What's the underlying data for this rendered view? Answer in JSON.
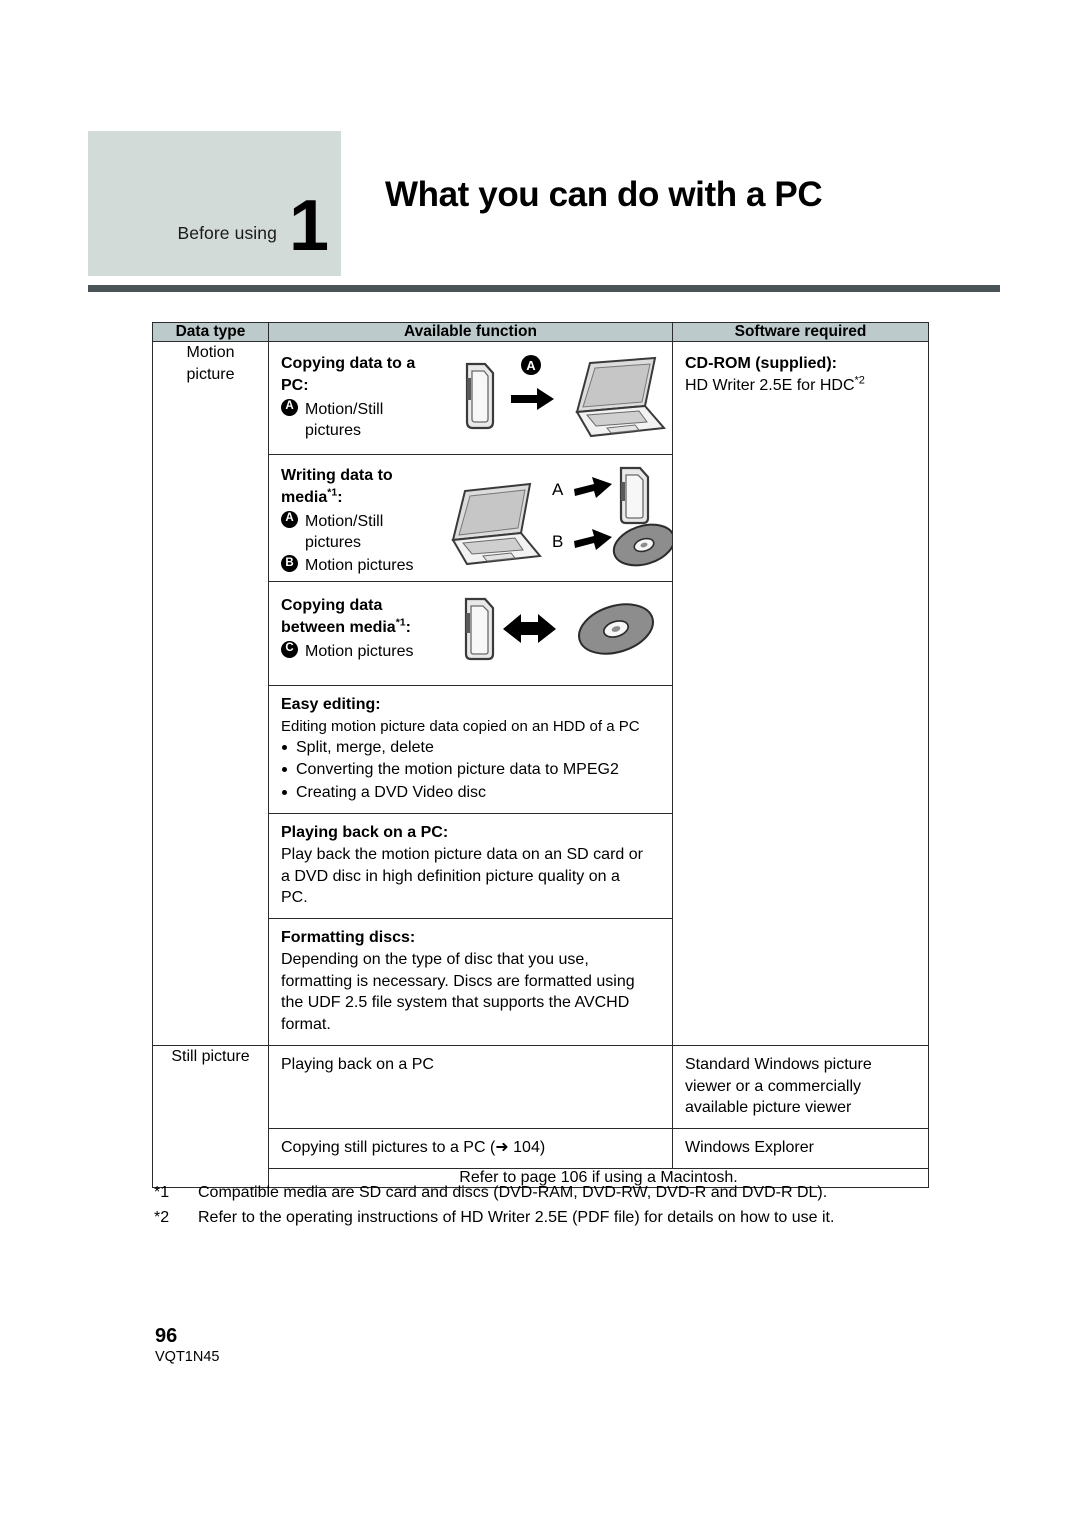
{
  "header": {
    "chapter_label": "Before using",
    "chapter_number": "1",
    "title": "What you can do with a PC"
  },
  "table": {
    "columns": [
      "Data type",
      "Available function",
      "Software required"
    ],
    "row_labels": {
      "motion": "Motion\npicture",
      "motion_line1": "Motion",
      "motion_line2": "picture",
      "still": "Still picture"
    },
    "software": {
      "cdrom_title": "CD-ROM (supplied):",
      "cdrom_body": "HD Writer 2.5E for HDC",
      "cdrom_ref": "*2",
      "still_viewer": "Standard Windows picture viewer or a commercially available picture viewer",
      "still_explorer": "Windows Explorer"
    },
    "functions": {
      "copy_to_pc": {
        "title_line1": "Copying data to a",
        "title_line2": "PC:",
        "badge_a": "A",
        "item_a_line1": "Motion/Still",
        "item_a_line2": "pictures",
        "diagram_label_a": "A"
      },
      "write_to_media": {
        "title_line1": "Writing data to",
        "title_line2": "media",
        "title_ref": "*1",
        "title_colon": ":",
        "badge_a": "A",
        "item_a_line1": "Motion/Still",
        "item_a_line2": "pictures",
        "badge_b": "B",
        "item_b": "Motion pictures",
        "diagram_label_a": "A",
        "diagram_label_b": "B"
      },
      "copy_between_media": {
        "title_line1": "Copying data",
        "title_line2": "between media",
        "title_ref": "*1",
        "title_colon": ":",
        "badge_c": "C",
        "item_c": "Motion pictures"
      },
      "easy_editing": {
        "title": "Easy editing:",
        "intro": "Editing motion picture data copied on an HDD of a PC",
        "bullets": [
          "Split, merge, delete",
          "Converting the motion picture data to MPEG2",
          "Creating a DVD Video disc"
        ]
      },
      "playing_back_pc": {
        "title": "Playing back on a PC:",
        "body_line1": "Play back the motion picture data on an SD card or",
        "body_line2": "a DVD disc in high definition picture quality on a",
        "body_line3": "PC."
      },
      "formatting_discs": {
        "title": "Formatting discs:",
        "body_line1": "Depending on the type of disc that you use,",
        "body_line2": "formatting is necessary. Discs are formatted using",
        "body_line3": "the UDF 2.5 file system that supports the AVCHD",
        "body_line4": "format."
      },
      "still_playing": "Playing back on a PC",
      "still_copying": "Copying still pictures to a PC (➜ 104)",
      "macintosh_note": "Refer to page 106 if using a Macintosh."
    }
  },
  "footnotes": [
    {
      "mark": "*1",
      "text": "Compatible media are SD card and discs (DVD-RAM, DVD-RW, DVD-R and DVD-R DL)."
    },
    {
      "mark": "*2",
      "text": "Refer to the operating instructions of HD Writer 2.5E (PDF file) for details on how to use it."
    }
  ],
  "page_footer": {
    "page_number": "96",
    "doc_code": "VQT1N45"
  },
  "colors": {
    "chapter_tag_bg": "#d3dbd9",
    "header_rule": "#4a5456",
    "table_header_bg": "#bdcacb",
    "border": "#2b2b2b"
  }
}
